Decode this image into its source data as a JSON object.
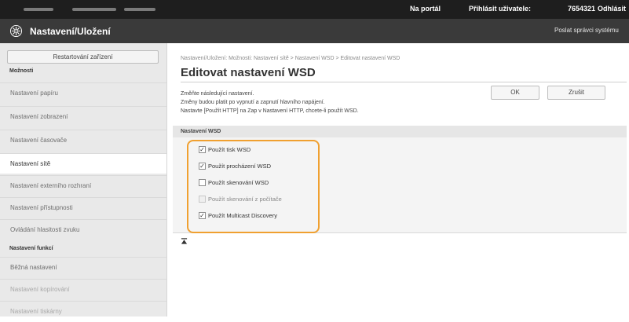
{
  "topbar": {
    "portal": "Na portál",
    "login_label": "Přihlásit uživatele:",
    "user_id": "7654321",
    "logout": "Odhlásit"
  },
  "header": {
    "title": "Nastavení/Uložení",
    "admin_link": "Poslat správci systému"
  },
  "sidebar": {
    "restart_button": "Restartování zařízení",
    "section_options": "Možnosti",
    "items": [
      {
        "label": "Nastavení papíru"
      },
      {
        "label": "Nastavení zobrazení"
      },
      {
        "label": "Nastavení časovače"
      },
      {
        "label": "Nastavení sítě"
      },
      {
        "label": "Nastavení externího rozhraní"
      },
      {
        "label": "Nastavení přístupnosti"
      },
      {
        "label": "Ovládání hlasitosti zvuku"
      }
    ],
    "section_functions": "Nastavení funkcí",
    "function_items": [
      {
        "label": "Běžná nastavení"
      },
      {
        "label": "Nastavení kopírování"
      },
      {
        "label": "Nastavení tiskárny"
      }
    ]
  },
  "main": {
    "breadcrumb": "Nastavení/Uložení: Možnosti: Nastavení sítě > Nastavení WSD > Editovat nastavení WSD",
    "title": "Editovat nastavení WSD",
    "desc_lines": [
      "Změňte následující nastavení.",
      "Změny budou platit po vypnutí a zapnutí hlavního napájení.",
      "Nastavte [Použít HTTP] na Zap v Nastavení HTTP, chcete-li použít WSD."
    ],
    "ok_button": "OK",
    "cancel_button": "Zrušit",
    "section_title": "Nastavení WSD",
    "options": [
      {
        "label": "Použít tisk WSD",
        "checked": "✓"
      },
      {
        "label": "Použít procházení WSD",
        "checked": "✓"
      },
      {
        "label": "Použít skenování WSD",
        "checked": ""
      },
      {
        "label": "Použít skenování z počítače",
        "checked": ""
      },
      {
        "label": "Použít Multicast Discovery",
        "checked": "✓"
      }
    ],
    "accent_color": "#f0a030"
  }
}
